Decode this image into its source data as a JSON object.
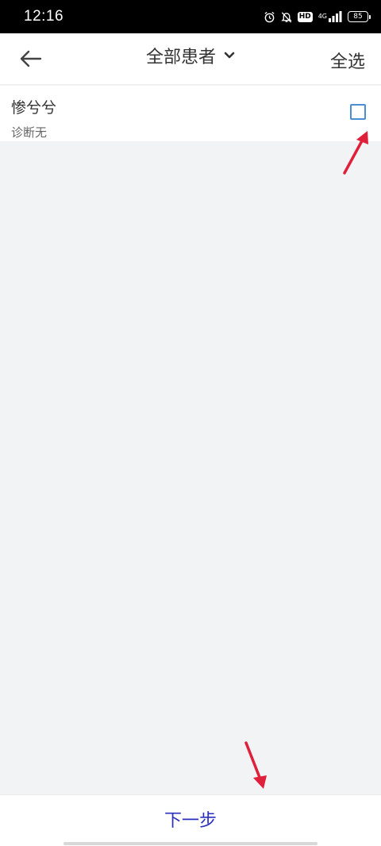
{
  "status_bar": {
    "time": "12:16",
    "icons": [
      "alarm-icon",
      "mute-icon",
      "hd-icon",
      "signal-icon",
      "battery-icon"
    ],
    "hd_label": "HD",
    "network_label": "4G",
    "battery": "85"
  },
  "header": {
    "back_icon": "back-arrow-icon",
    "title": "全部患者",
    "dropdown_icon": "chevron-down-icon",
    "select_all": "全选"
  },
  "patients": [
    {
      "name": "惨兮兮",
      "diagnosis": "诊断无",
      "checked": false
    }
  ],
  "footer": {
    "next_label": "下一步"
  },
  "colors": {
    "accent_blue": "#2a2fc0",
    "checkbox_border": "#4a8fd4",
    "annotation_red": "#e0203a",
    "background": "#f2f3f5"
  }
}
